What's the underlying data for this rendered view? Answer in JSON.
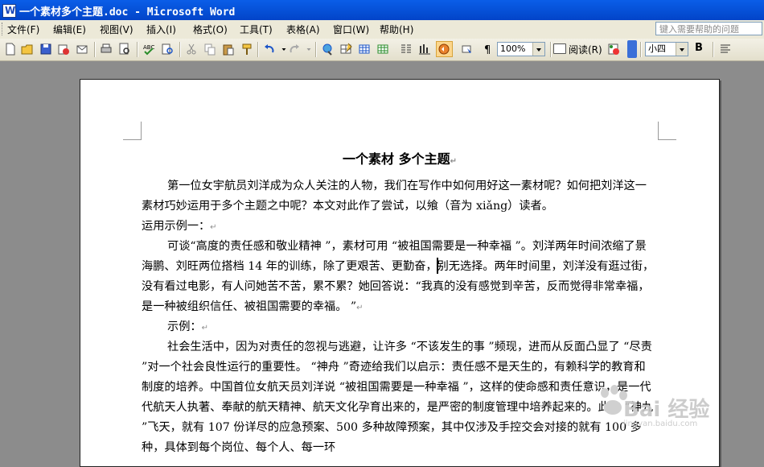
{
  "window": {
    "title": "一个素材多个主题.doc - Microsoft Word"
  },
  "menubar": {
    "items": [
      "文件(F)",
      "编辑(E)",
      "视图(V)",
      "插入(I)",
      "格式(O)",
      "工具(T)",
      "表格(A)",
      "窗口(W)",
      "帮助(H)"
    ],
    "help_placeholder": "键入需要帮助的问题"
  },
  "toolbar": {
    "zoom": "100%",
    "read_label": "阅读(R)",
    "font_size": "小四",
    "bold_label": "B",
    "icons": [
      "new-document-icon",
      "open-folder-icon",
      "save-icon",
      "permission-icon",
      "email-icon",
      "print-icon",
      "print-preview-icon",
      "spelling-icon",
      "research-icon",
      "cut-icon",
      "copy-icon",
      "paste-icon",
      "format-painter-icon",
      "undo-icon",
      "redo-icon",
      "hyperlink-icon",
      "tables-borders-icon",
      "insert-table-icon",
      "insert-excel-icon",
      "columns-icon",
      "drawing-icon",
      "document-map-icon",
      "show-hide-icon",
      "zoom-icon",
      "help-icon"
    ]
  },
  "document": {
    "title": "一个素材 多个主题",
    "paragraphs": [
      "第一位女宇航员刘洋成为众人关注的人物，我们在写作中如何用好这一素材呢？如何把刘洋这一素材巧妙运用于多个主题之中呢？本文对此作了尝试，以飨（音为 xiǎng）读者。",
      "运用示例一：",
      "可谈“高度的责任感和敬业精神 ”，素材可用 “被祖国需要是一种幸福 ”。刘洋两年时间浓缩了景海鹏、刘旺两位搭档 14 年的训练，除了更艰苦、更勤奋，别无选择。两年时间里，刘洋没有逛过街，没有看过电影，有人问她苦不苦，累不累？她回答说：“我真的没有感觉到辛苦，反而觉得非常幸福，是一种被组织信任、被祖国需要的幸福。 ”",
      "示例：",
      "社会生活中，因为对责任的忽视与逃避，让许多 “不该发生的事 ”频现，进而从反面凸显了 “尽责 ”对一个社会良性运行的重要性。 “神舟 ”奇迹给我们以启示：责任感不是天生的，有赖科学的教育和制度的培养。中国首位女航天员刘洋说 “被祖国需要是一种幸福 ”，这样的使命感和责任意识，是一代代航天人执著、奉献的航天精神、航天文化孕育出来的，是严密的制度管理中培养起来的。此次 “神九 ”飞天，就有 107 份详尽的应急预案、500 多种故障预案，其中仅涉及手控交会对接的就有 100 多种，具体到每个岗位、每个人、每一环"
    ],
    "paragraph_mark": "↵"
  },
  "watermark": {
    "text": "Bai 经验",
    "sub": "jingyan.baidu.com"
  }
}
